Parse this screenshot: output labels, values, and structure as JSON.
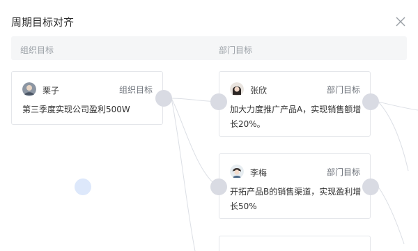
{
  "dialog": {
    "title": "周期目标对齐",
    "close_icon": "close-icon"
  },
  "columns": [
    {
      "label": "组织目标"
    },
    {
      "label": "部门目标"
    }
  ],
  "org_goal": {
    "owner": "栗子",
    "type": "组织目标",
    "content": "第三季度实现公司盈利500W"
  },
  "dept_goals": [
    {
      "owner": "张欣",
      "type": "部门目标",
      "content_line1": "加大力度推广产品A，实现销售额增",
      "content_line2": "长20%。"
    },
    {
      "owner": "李梅",
      "type": "部门目标",
      "content_line1": "开拓产品B的销售渠道，实现盈利增",
      "content_line2": "长50%"
    }
  ],
  "colors": {
    "node": "#d9dbe3",
    "node_blue": "#dde8fb",
    "line": "#dcdfe5"
  }
}
